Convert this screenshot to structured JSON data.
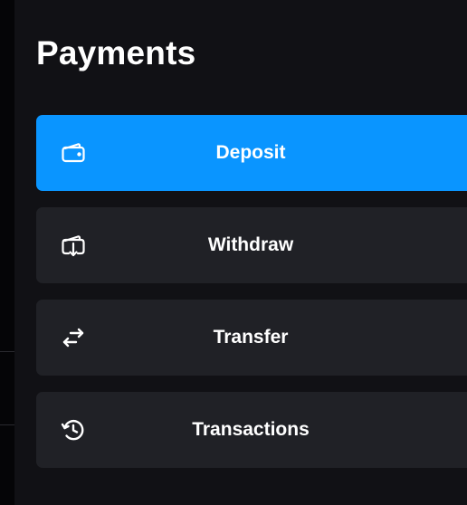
{
  "header": {
    "title": "Payments"
  },
  "menu": {
    "items": [
      {
        "label": "Deposit",
        "icon": "wallet-icon",
        "active": true
      },
      {
        "label": "Withdraw",
        "icon": "wallet-download-icon",
        "active": false
      },
      {
        "label": "Transfer",
        "icon": "transfer-arrows-icon",
        "active": false
      },
      {
        "label": "Transactions",
        "icon": "history-icon",
        "active": false
      }
    ]
  },
  "colors": {
    "accent": "#0a95ff",
    "item_background": "#202126",
    "panel_background": "#111115"
  }
}
